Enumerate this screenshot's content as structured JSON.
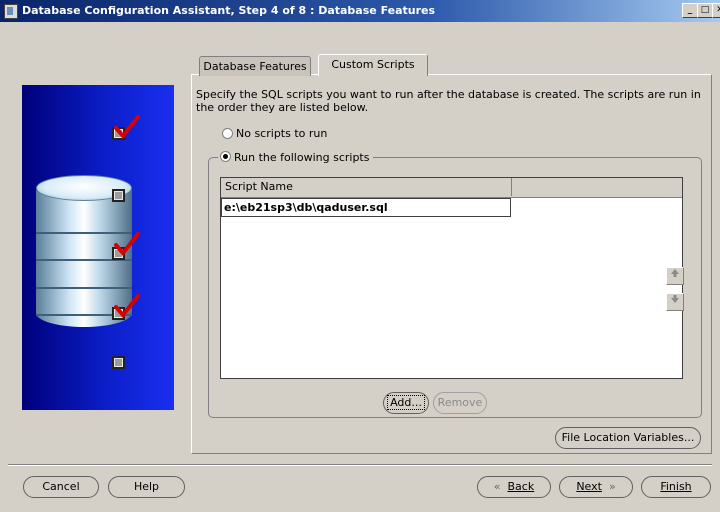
{
  "window": {
    "title": "Database Configuration Assistant, Step 4 of 8 : Database Features",
    "controls": [
      "_",
      "□",
      "✕"
    ]
  },
  "tabs": [
    {
      "label": "Database Features",
      "active": false
    },
    {
      "label": "Custom Scripts",
      "active": true
    }
  ],
  "description": "Specify the SQL scripts you want to run after the database is created. The scripts are run in the order they are listed below.",
  "options": {
    "no_scripts": "No scripts to run",
    "run_scripts": "Run the following scripts",
    "selected": "run_scripts"
  },
  "scripts_table": {
    "columns": [
      "Script Name",
      ""
    ],
    "rows": [
      "e:\\eb21sp3\\db\\qaduser.sql"
    ]
  },
  "buttons": {
    "add": "Add...",
    "remove": "Remove",
    "file_location": "File Location Variables...",
    "cancel": "Cancel",
    "help": "Help",
    "back": "Back",
    "next": "Next",
    "finish": "Finish"
  },
  "icons": {
    "back": "«",
    "next": "»",
    "move_up": "arrow-up",
    "move_down": "arrow-down"
  },
  "colors": {
    "titlebar": "#0a246a",
    "panel_blue": "#0b1ec8",
    "check_red": "#d80000"
  }
}
